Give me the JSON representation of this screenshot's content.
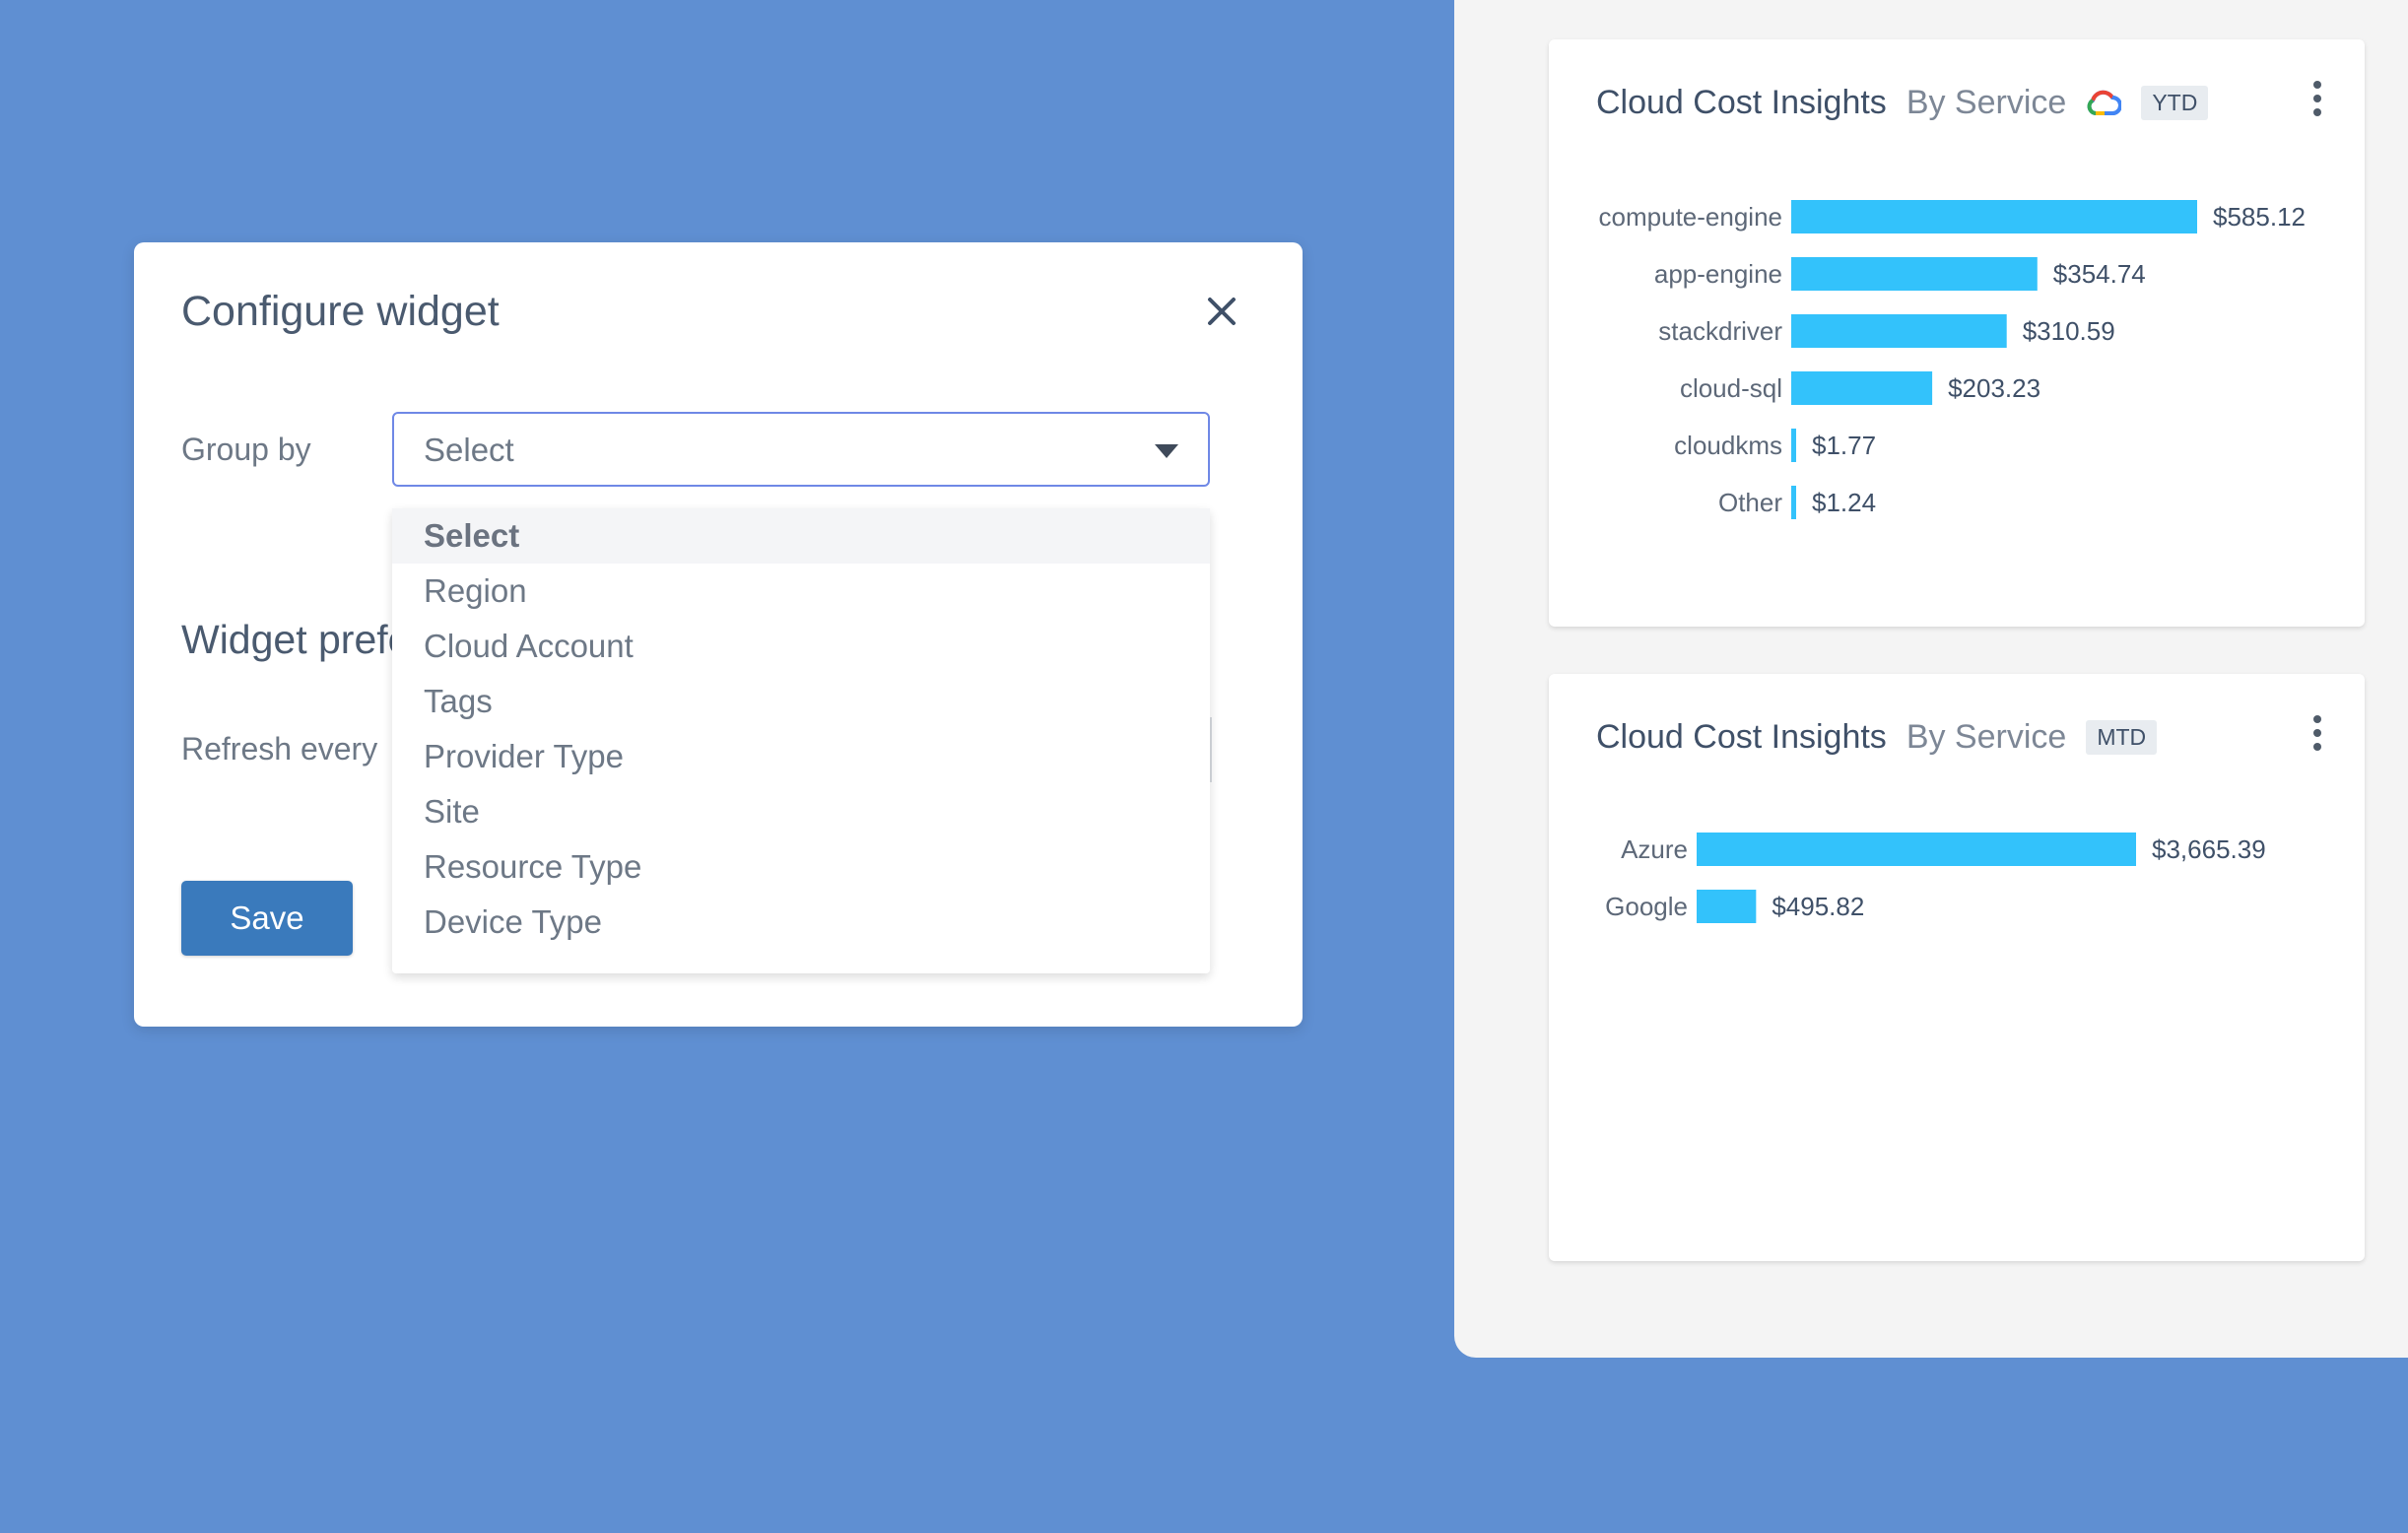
{
  "modal": {
    "title": "Configure widget",
    "group_by_label": "Group by",
    "select_value": "Select",
    "widget_preferences_label": "Widget preferences",
    "refresh_label": "Refresh every",
    "save_label": "Save",
    "dropdown_options": [
      "Select",
      "Region",
      "Cloud Account",
      "Tags",
      "Provider Type",
      "Site",
      "Resource Type",
      "Device Type"
    ]
  },
  "widgets": [
    {
      "title": "Cloud Cost Insights",
      "subtitle": "By Service",
      "badge": "YTD",
      "provider_icon": "google-cloud-icon"
    },
    {
      "title": "Cloud Cost Insights",
      "subtitle": "By Service",
      "badge": "MTD"
    }
  ],
  "colors": {
    "bar": "#33c2fb",
    "page_bg": "#5f8fd2",
    "accent": "#3a7abc"
  },
  "chart_data": [
    {
      "type": "bar",
      "orientation": "horizontal",
      "categories": [
        "compute-engine",
        "app-engine",
        "stackdriver",
        "cloud-sql",
        "cloudkms",
        "Other"
      ],
      "values": [
        585.12,
        354.74,
        310.59,
        203.23,
        1.77,
        1.24
      ],
      "labels": [
        "$585.12",
        "$354.74",
        "$310.59",
        "$203.23",
        "$1.77",
        "$1.24"
      ]
    },
    {
      "type": "bar",
      "orientation": "horizontal",
      "categories": [
        "Azure",
        "Google"
      ],
      "values": [
        3665.39,
        495.82
      ],
      "labels": [
        "$3,665.39",
        "$495.82"
      ]
    }
  ]
}
